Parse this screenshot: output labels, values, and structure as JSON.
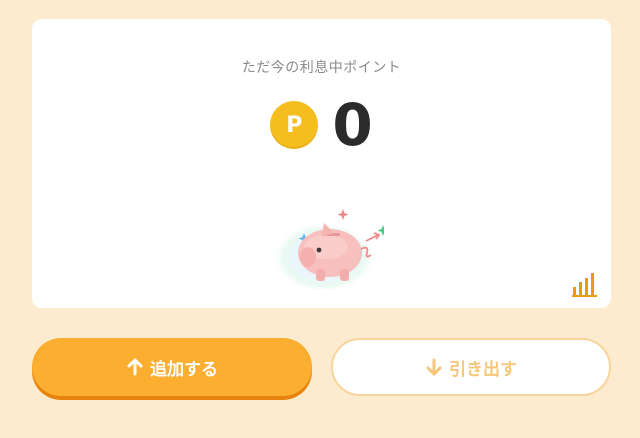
{
  "card": {
    "title": "ただ今の利息中ポイント",
    "coin_label": "P",
    "points": "0"
  },
  "icons": {
    "coin": "point-coin-icon",
    "pig": "piggy-bank-illustration",
    "chart": "bar-chart-icon",
    "up": "arrow-up-icon",
    "down": "arrow-down-icon"
  },
  "actions": {
    "add_label": "追加する",
    "withdraw_label": "引き出す"
  },
  "colors": {
    "background": "#fdebd0",
    "coin": "#f5bd1e",
    "primary": "#fbae2f",
    "primary_shadow": "#e8830e",
    "withdraw_text": "#f6c77a",
    "chart_icon": "#e89a12"
  }
}
